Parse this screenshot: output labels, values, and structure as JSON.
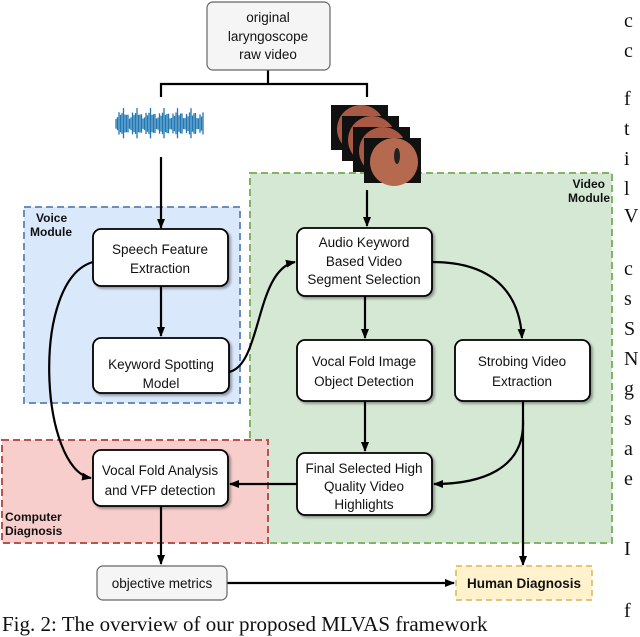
{
  "nodes": {
    "source": [
      "original",
      "laryngoscope",
      "raw video"
    ],
    "speech": [
      "Speech Feature",
      "Extraction"
    ],
    "kws": [
      "Keyword Spotting",
      "Model"
    ],
    "audio_kw": [
      "Audio Keyword",
      "Based Video",
      "Segment Selection"
    ],
    "vf_det": [
      "Vocal Fold Image",
      "Object Detection"
    ],
    "strobe": [
      "Strobing Video",
      "Extraction"
    ],
    "final": [
      "Final Selected High",
      "Quality Video",
      "Highlights"
    ],
    "analysis": [
      "Vocal Fold Analysis",
      "and VFP detection"
    ],
    "metrics": "objective metrics",
    "human": "Human Diagnosis"
  },
  "groups": {
    "voice": [
      "Voice",
      "Module"
    ],
    "video": [
      "Video",
      "Module"
    ],
    "computer": [
      "Computer",
      "Diagnosis"
    ]
  },
  "colors": {
    "voice": "#dae8fc",
    "video": "#d5e8d4",
    "computer": "#f8cecc",
    "human": "#fff2cc",
    "wave": "#1f77b4"
  },
  "caption": "Fig. 2: The overview of our proposed MLVAS framework",
  "right_column": [
    "c",
    "c",
    "f",
    "t",
    "i",
    "l",
    "V",
    "c",
    "s",
    "S",
    "N",
    "g",
    "s",
    "a",
    "e",
    "I",
    "f"
  ]
}
